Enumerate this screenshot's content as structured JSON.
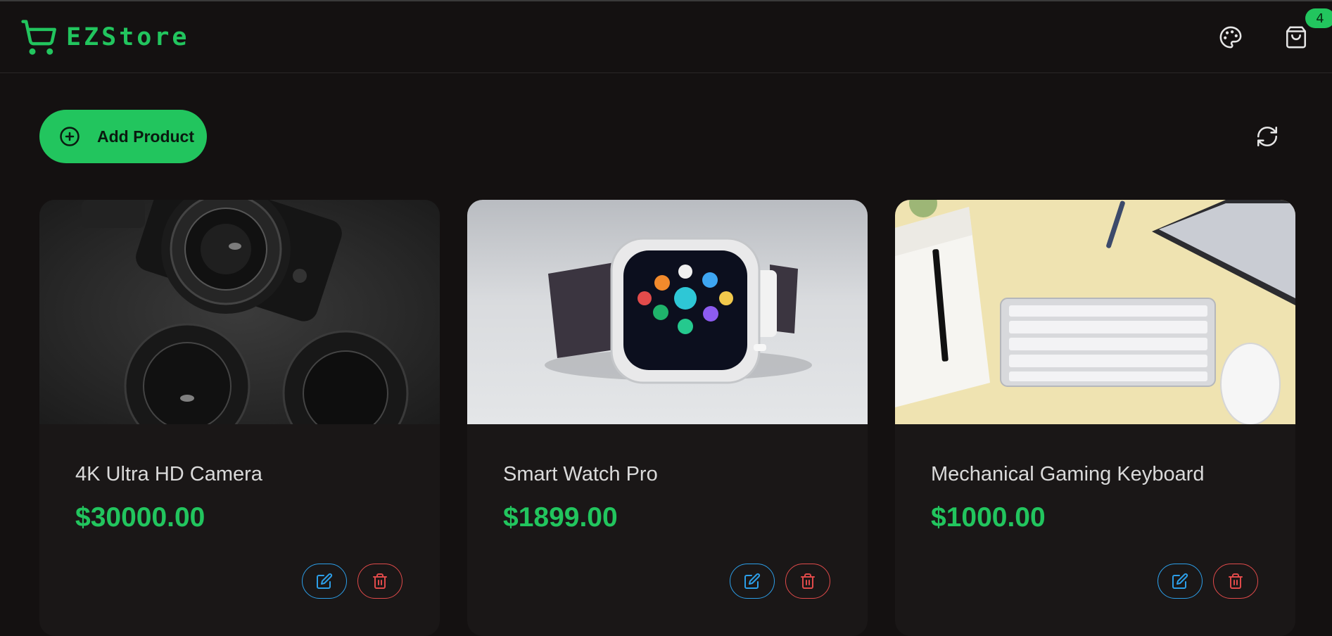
{
  "brand": {
    "name": "EZStore",
    "logo_icon": "shopping-cart-icon",
    "accent": "#22c55e"
  },
  "header": {
    "theme_icon": "palette-icon",
    "cart_icon": "shopping-bag-icon",
    "cart_count": "4"
  },
  "toolbar": {
    "add_label": "Add Product",
    "add_icon": "plus-circle-icon",
    "refresh_icon": "refresh-icon"
  },
  "products": [
    {
      "name": "4K Ultra HD Camera",
      "price": "$30000.00",
      "image": "camera-lenses-photo"
    },
    {
      "name": "Smart Watch Pro",
      "price": "$1899.00",
      "image": "smart-watch-photo"
    },
    {
      "name": "Mechanical Gaming Keyboard",
      "price": "$1000.00",
      "image": "keyboard-desk-photo"
    }
  ],
  "colors": {
    "background": "#141111",
    "card": "#1a1717",
    "edit": "#2c9ee8",
    "delete": "#e04a4a"
  }
}
